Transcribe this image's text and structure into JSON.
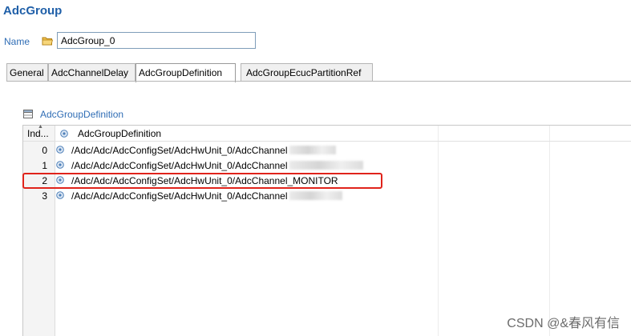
{
  "editor": {
    "title": "AdcGroup",
    "name_label": "Name",
    "name_value": "AdcGroup_0"
  },
  "tabs": [
    {
      "label": "General",
      "active": false
    },
    {
      "label": "AdcChannelDelay",
      "active": false
    },
    {
      "label": "AdcGroupDefinition",
      "active": true
    },
    {
      "label": "AdcGroupEcucPartitionRef",
      "active": false
    }
  ],
  "section": {
    "title": "AdcGroupDefinition",
    "columns": [
      "Ind...",
      "AdcGroupDefinition"
    ],
    "rows": [
      {
        "index": "0",
        "path": "/Adc/Adc/AdcConfigSet/AdcHwUnit_0/AdcChannel",
        "suffix": "",
        "selected": false
      },
      {
        "index": "1",
        "path": "/Adc/Adc/AdcConfigSet/AdcHwUnit_0/AdcChannel",
        "suffix": "",
        "selected": false
      },
      {
        "index": "2",
        "path": "/Adc/Adc/AdcConfigSet/AdcHwUnit_0/AdcChannel_MONITOR",
        "suffix": "",
        "selected": true
      },
      {
        "index": "3",
        "path": "/Adc/Adc/AdcConfigSet/AdcHwUnit_0/AdcChannel",
        "suffix": "",
        "selected": false
      }
    ]
  },
  "icons": {
    "folder": "folder-icon",
    "table": "table-icon",
    "reference": "reference-icon"
  },
  "watermark": "CSDN @&春风有信",
  "colors": {
    "title": "#1f5fa8",
    "label": "#2f6db5",
    "highlight": "#e0231b"
  }
}
